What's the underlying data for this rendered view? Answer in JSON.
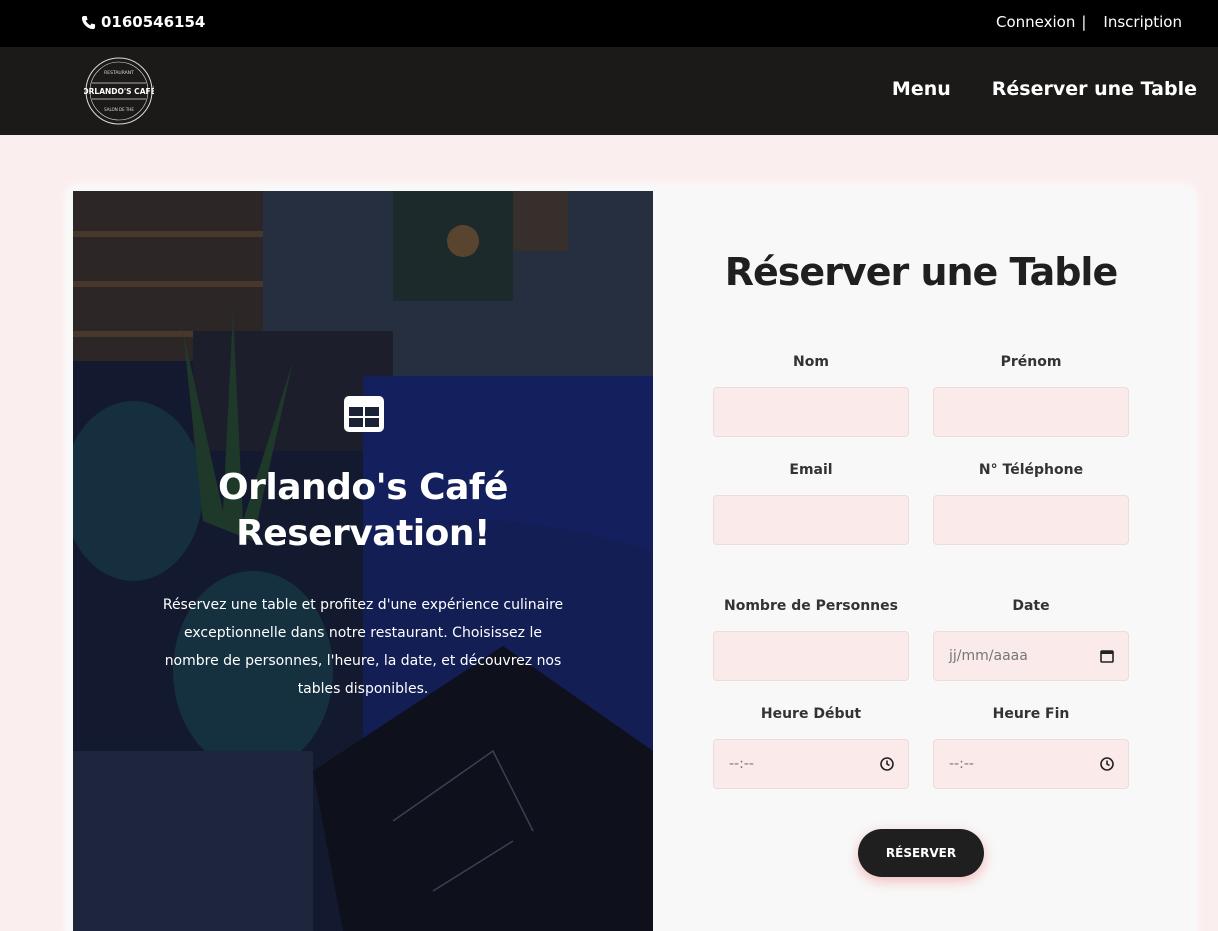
{
  "topbar": {
    "phone": "0160546154",
    "login": "Connexion",
    "separator": "|",
    "register": "Inscription"
  },
  "logo": {
    "top_text": "RESTAURANT",
    "name": "ORLANDO'S CAFÉ",
    "bottom_text": "SALON DE THE"
  },
  "nav": {
    "menu": "Menu",
    "reserve": "Réserver une Table"
  },
  "hero": {
    "title_line1": "Orlando's Café",
    "title_line2": "Reservation!",
    "text": "Réservez une table et profitez d'une expérience culinaire exceptionnelle dans notre restaurant. Choisissez le nombre de personnes, l'heure, la date, et découvrez nos tables disponibles."
  },
  "form": {
    "title": "Réserver une Table",
    "nom_label": "Nom",
    "prenom_label": "Prénom",
    "email_label": "Email",
    "tel_label": "N° Téléphone",
    "personnes_label": "Nombre de Personnes",
    "date_label": "Date",
    "date_placeholder": "jj/mm/aaaa",
    "heure_debut_label": "Heure Début",
    "heure_debut_placeholder": "--:--",
    "heure_fin_label": "Heure Fin",
    "heure_fin_placeholder": "--:--",
    "submit": "RÉSERVER"
  }
}
